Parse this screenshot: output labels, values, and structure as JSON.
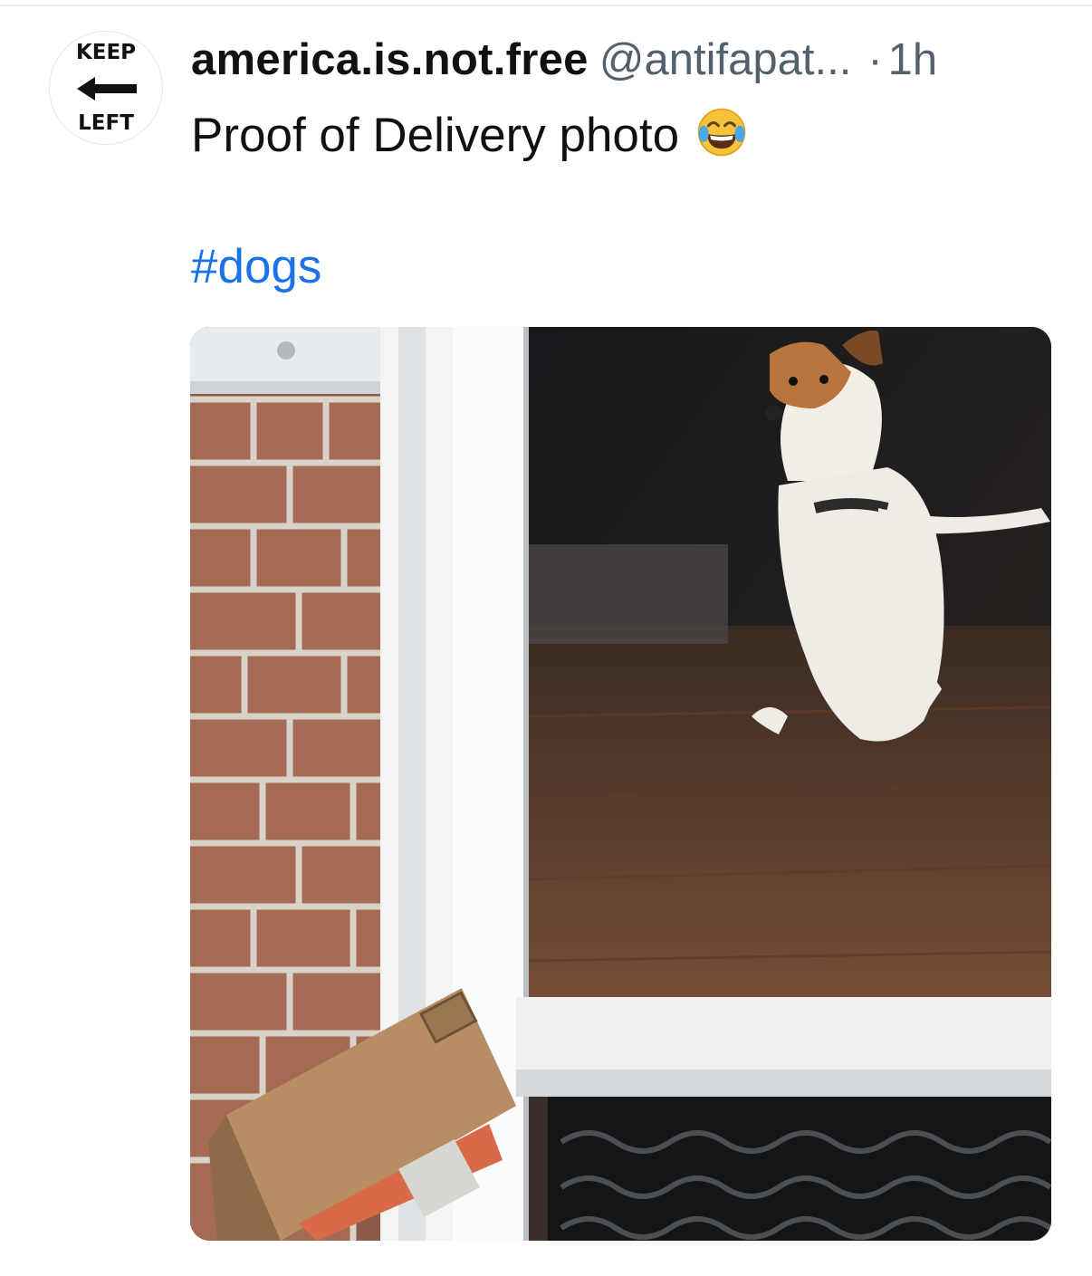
{
  "post": {
    "avatar": {
      "top_text": "KEEP",
      "bottom_text": "LEFT",
      "icon": "left-arrow-icon"
    },
    "author_name": "america.is.not.free",
    "author_handle": "@antifapat...",
    "separator": "·",
    "time_ago": "1h",
    "text": "Proof of Delivery photo",
    "emoji": "face-with-tears-of-joy-icon",
    "hashtag": "#dogs",
    "media": {
      "kind": "photo",
      "subject": "dog-jumping-at-glass-door-with-package-icon"
    }
  },
  "colors": {
    "text": "#111111",
    "muted": "#53606d",
    "link": "#1a73e8",
    "divider": "#eceef0"
  }
}
